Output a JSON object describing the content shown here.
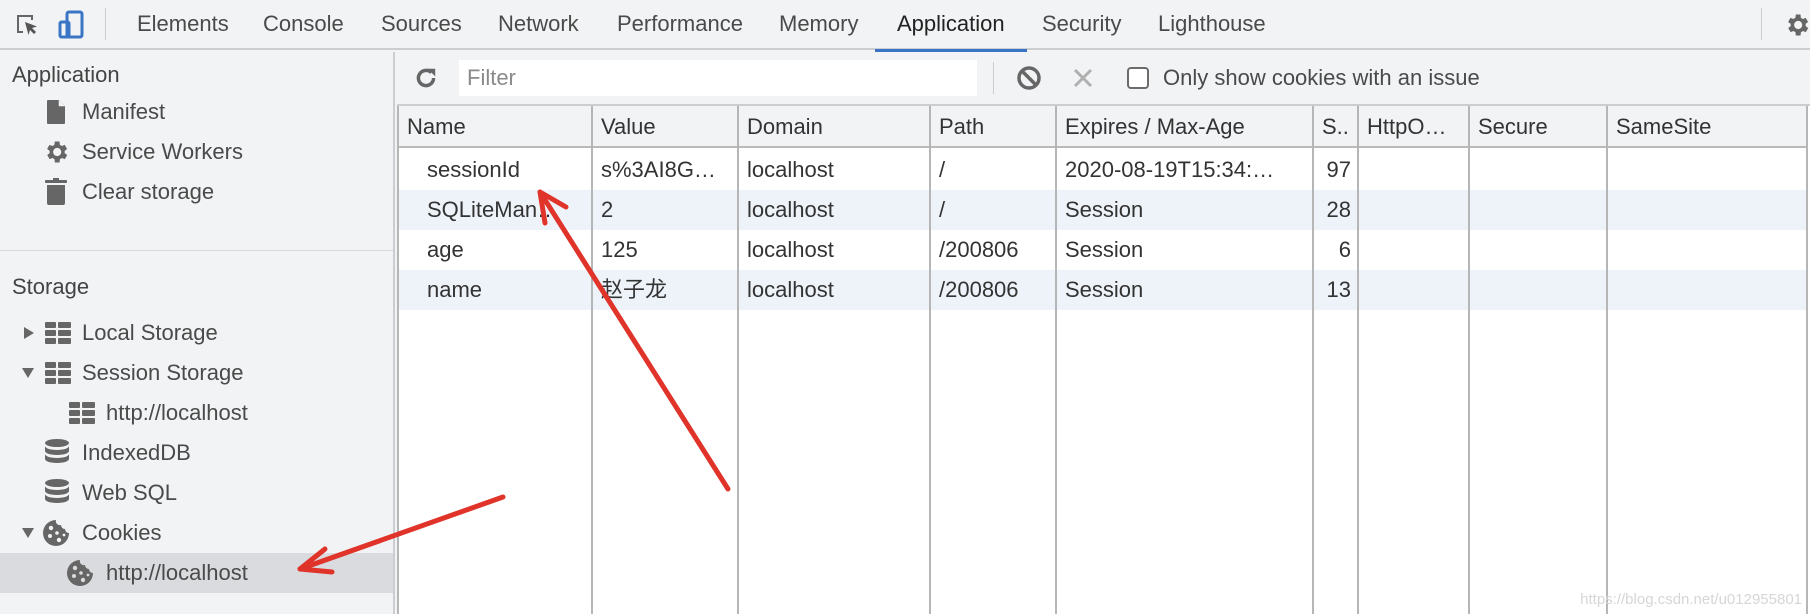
{
  "topbar": {
    "inspect_icon": "inspect-element-icon",
    "device_icon": "device-toolbar-icon",
    "tabs": [
      {
        "label": "Elements",
        "active": false
      },
      {
        "label": "Console",
        "active": false
      },
      {
        "label": "Sources",
        "active": false
      },
      {
        "label": "Network",
        "active": false
      },
      {
        "label": "Performance",
        "active": false
      },
      {
        "label": "Memory",
        "active": false
      },
      {
        "label": "Application",
        "active": true
      },
      {
        "label": "Security",
        "active": false
      },
      {
        "label": "Lighthouse",
        "active": false
      }
    ],
    "settings_icon": "gear-icon",
    "accent_color": "#3a74c4"
  },
  "sidebar": {
    "application": {
      "title": "Application",
      "items": [
        {
          "label": "Manifest",
          "icon": "document-icon"
        },
        {
          "label": "Service Workers",
          "icon": "gear-icon"
        },
        {
          "label": "Clear storage",
          "icon": "trash-icon"
        }
      ]
    },
    "storage": {
      "title": "Storage",
      "items": [
        {
          "label": "Local Storage",
          "icon": "table-icon",
          "expanded": false
        },
        {
          "label": "Session Storage",
          "icon": "table-icon",
          "expanded": true
        },
        {
          "label": "http://localhost",
          "icon": "table-icon",
          "child": true
        },
        {
          "label": "IndexedDB",
          "icon": "database-icon"
        },
        {
          "label": "Web SQL",
          "icon": "database-icon"
        },
        {
          "label": "Cookies",
          "icon": "cookie-icon",
          "expanded": true
        },
        {
          "label": "http://localhost",
          "icon": "cookie-icon",
          "child": true,
          "selected": true
        }
      ]
    }
  },
  "toolbar": {
    "refresh_icon": "refresh-icon",
    "filter_placeholder": "Filter",
    "filter_value": "",
    "clear_all_icon": "block-icon",
    "delete_selected_icon": "close-icon",
    "issue_checkbox_label": "Only show cookies with an issue",
    "issue_checkbox_checked": false
  },
  "table": {
    "columns": [
      "Name",
      "Value",
      "Domain",
      "Path",
      "Expires / Max-Age",
      "S..",
      "HttpO…",
      "Secure",
      "SameSite"
    ],
    "rows": [
      {
        "name": "sessionId",
        "value": "s%3AI8G…",
        "domain": "localhost",
        "path": "/",
        "expires": "2020-08-19T15:34:…",
        "size": "97",
        "httponly": "",
        "secure": "",
        "samesite": ""
      },
      {
        "name": "SQLiteMan…",
        "value": "2",
        "domain": "localhost",
        "path": "/",
        "expires": "Session",
        "size": "28",
        "httponly": "",
        "secure": "",
        "samesite": ""
      },
      {
        "name": "age",
        "value": "125",
        "domain": "localhost",
        "path": "/200806",
        "expires": "Session",
        "size": "6",
        "httponly": "",
        "secure": "",
        "samesite": ""
      },
      {
        "name": "name",
        "value": "赵子龙",
        "domain": "localhost",
        "path": "/200806",
        "expires": "Session",
        "size": "13",
        "httponly": "",
        "secure": "",
        "samesite": ""
      }
    ]
  },
  "watermark": "https://blog.csdn.net/u012955801",
  "annotation_color": "#e0332a"
}
